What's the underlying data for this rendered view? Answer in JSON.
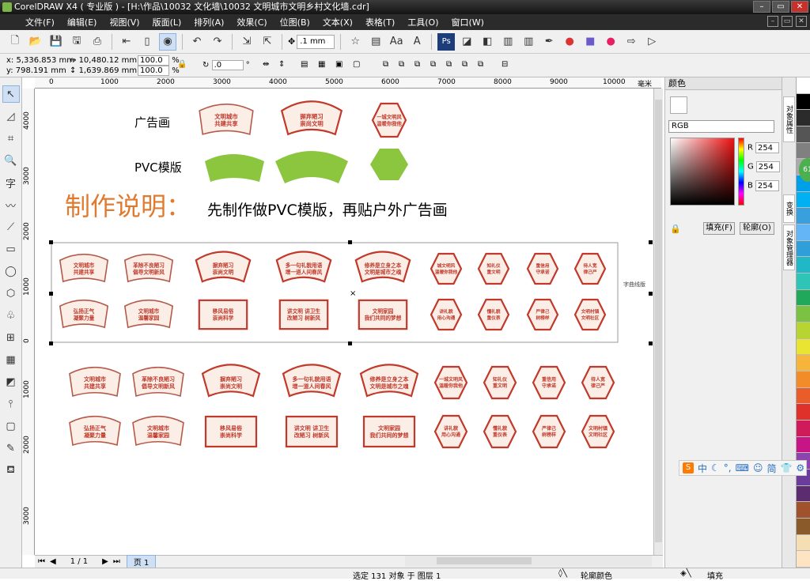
{
  "window": {
    "title": "CorelDRAW X4 ( 专业版 ) - [H:\\作品\\10032 文化墙\\10032 文明城市文明乡村文化墙.cdr]",
    "controls": {
      "minimize": "–",
      "restore": "▭",
      "close": "✕"
    }
  },
  "menu": [
    "文件(F)",
    "编辑(E)",
    "视图(V)",
    "版面(L)",
    "排列(A)",
    "效果(C)",
    "位图(B)",
    "文本(X)",
    "表格(T)",
    "工具(O)",
    "窗口(W)"
  ],
  "toolbar": {
    "nudge_value": ".1 mm"
  },
  "properties": {
    "x": "x: 5,336.853 mm",
    "y": "y: 798.191 mm",
    "width": "10,480.12 mm",
    "height": "1,639.869 mm",
    "scale_x": "100.0",
    "scale_y": "100.0",
    "pct": "%",
    "angle": ".0",
    "degree": "°"
  },
  "ruler": {
    "h_ticks": [
      "0",
      "1000",
      "2000",
      "3000",
      "4000",
      "5000",
      "6000",
      "7000",
      "8000",
      "9000",
      "10000",
      "毫米"
    ],
    "v_ticks": [
      "4000",
      "3000",
      "2000",
      "1000",
      "0",
      "1000",
      "2000",
      "3000"
    ]
  },
  "canvas": {
    "label_ad": "广告画",
    "label_pvc": "PVC模版",
    "heading": "制作说明：",
    "instruction": "先制作做PVC模版，再贴户外广告画",
    "side_note": "字曲线版",
    "signs_top": [
      {
        "shape": "fan-scroll",
        "text": [
          "文明城市",
          "共建共享"
        ]
      },
      {
        "shape": "fan-arch",
        "text": [
          "摒弃陋习",
          "崇尚文明"
        ]
      },
      {
        "shape": "hexagon",
        "text": [
          "一城文明风",
          "温暖你我他"
        ]
      }
    ],
    "sel_row1": [
      {
        "shape": "fan-scroll",
        "text": [
          "文明城市",
          "共建共享"
        ]
      },
      {
        "shape": "fan-scroll",
        "text": [
          "革除不良陋习",
          "倡导文明新风"
        ]
      },
      {
        "shape": "fan-arch",
        "text": [
          "摒弃陋习",
          "崇尚文明"
        ]
      },
      {
        "shape": "fan-arch",
        "text": [
          "多一句礼貌用语",
          "增一道人间春风"
        ]
      },
      {
        "shape": "fan-arch",
        "text": [
          "修养是立身之本",
          "文明是城市之魂"
        ]
      },
      {
        "shape": "hexagon",
        "text": [
          "城文明风",
          "温暖你我他"
        ]
      },
      {
        "shape": "hexagon",
        "text": [
          "知礼仪",
          "重文明"
        ]
      },
      {
        "shape": "hexagon",
        "text": [
          "重信用",
          "守承诺"
        ]
      },
      {
        "shape": "hexagon",
        "text": [
          "待人宽",
          "律己严"
        ]
      }
    ],
    "sel_row2": [
      {
        "shape": "fan-scroll",
        "text": [
          "弘扬正气",
          "凝聚力量"
        ]
      },
      {
        "shape": "fan-scroll",
        "text": [
          "文明城市",
          "温馨家园"
        ]
      },
      {
        "shape": "rect",
        "text": [
          "移风易俗",
          "崇尚科学"
        ]
      },
      {
        "shape": "rect",
        "text": [
          "讲文明 讲卫生",
          "改陋习 树新风"
        ]
      },
      {
        "shape": "rect",
        "text": [
          "文明家园",
          "我们共同的梦想"
        ]
      },
      {
        "shape": "hexagon",
        "text": [
          "讲礼貌",
          "用心沟通"
        ]
      },
      {
        "shape": "hexagon",
        "text": [
          "懂礼貌",
          "重仪表"
        ]
      },
      {
        "shape": "hexagon",
        "text": [
          "严律己",
          "树榜样"
        ]
      },
      {
        "shape": "hexagon",
        "text": [
          "文明村镇",
          "文明社区"
        ]
      }
    ],
    "bottom_row1": [
      {
        "shape": "fan-scroll",
        "text": [
          "文明城市",
          "共建共享"
        ]
      },
      {
        "shape": "fan-scroll",
        "text": [
          "革除不良陋习",
          "倡导文明新风"
        ]
      },
      {
        "shape": "fan-arch",
        "text": [
          "摒弃陋习",
          "崇尚文明"
        ]
      },
      {
        "shape": "fan-arch",
        "text": [
          "多一句礼貌用语",
          "增一道人间春风"
        ]
      },
      {
        "shape": "fan-arch",
        "text": [
          "修养是立身之本",
          "文明是城市之魂"
        ]
      },
      {
        "shape": "hexagon",
        "text": [
          "一城文明风",
          "温暖你我他"
        ]
      },
      {
        "shape": "hexagon",
        "text": [
          "知礼仪",
          "重文明"
        ]
      },
      {
        "shape": "hexagon",
        "text": [
          "重信用",
          "守承诺"
        ]
      },
      {
        "shape": "hexagon",
        "text": [
          "待人宽",
          "律己严"
        ]
      }
    ],
    "bottom_row2": [
      {
        "shape": "fan-scroll",
        "text": [
          "弘扬正气",
          "凝聚力量"
        ]
      },
      {
        "shape": "fan-scroll",
        "text": [
          "文明城市",
          "温馨家园"
        ]
      },
      {
        "shape": "rect",
        "text": [
          "移风易俗",
          "崇尚科学"
        ]
      },
      {
        "shape": "rect",
        "text": [
          "讲文明 讲卫生",
          "改陋习 树新风"
        ]
      },
      {
        "shape": "rect",
        "text": [
          "文明家园",
          "我们共同的梦想"
        ]
      },
      {
        "shape": "hexagon",
        "text": [
          "讲礼貌",
          "用心沟通"
        ]
      },
      {
        "shape": "hexagon",
        "text": [
          "懂礼貌",
          "重仪表"
        ]
      },
      {
        "shape": "hexagon",
        "text": [
          "严律己",
          "树榜样"
        ]
      },
      {
        "shape": "hexagon",
        "text": [
          "文明村镇",
          "文明社区"
        ]
      }
    ]
  },
  "navigator": {
    "page_count": "1 / 1",
    "page_tab": "页 1"
  },
  "status": {
    "selection": "选定 131 对象 于 图层 1",
    "outline": "轮廓颜色",
    "fill": "填充"
  },
  "docker": {
    "title": "颜色",
    "model": "RGB",
    "r_label": "R",
    "r": "254",
    "g_label": "G",
    "g": "254",
    "b_label": "B",
    "b": "254",
    "fill_btn": "填充(F)",
    "outline_btn": "轮廓(O)",
    "tabs": [
      "对象属性",
      "变换",
      "对象管理器"
    ]
  },
  "ime": {
    "logo": "S",
    "lang": "中",
    "simp": "简"
  },
  "colors": {
    "accent_orange": "#e07a2e",
    "pvc_green": "#8cc63f",
    "sign_red": "#c0392b",
    "sign_cream": "#fbeee6",
    "palette": [
      "#ffffff",
      "#000000",
      "#2b2b2b",
      "#555555",
      "#808080",
      "#aaaaaa",
      "#00a0e9",
      "#00b0f0",
      "#3aa0dd",
      "#64b5f6",
      "#2e9fd8",
      "#20b7c6",
      "#2ec4b6",
      "#22a85a",
      "#7cc242",
      "#b7d433",
      "#e9e332",
      "#f6b53a",
      "#f28c28",
      "#e85d2a",
      "#e0302a",
      "#d01b5b",
      "#c71585",
      "#8e44ad",
      "#6a3d9a",
      "#5b2c6f",
      "#a0522d",
      "#8b5a2b",
      "#f5deb3",
      "#ffe4c4"
    ]
  }
}
